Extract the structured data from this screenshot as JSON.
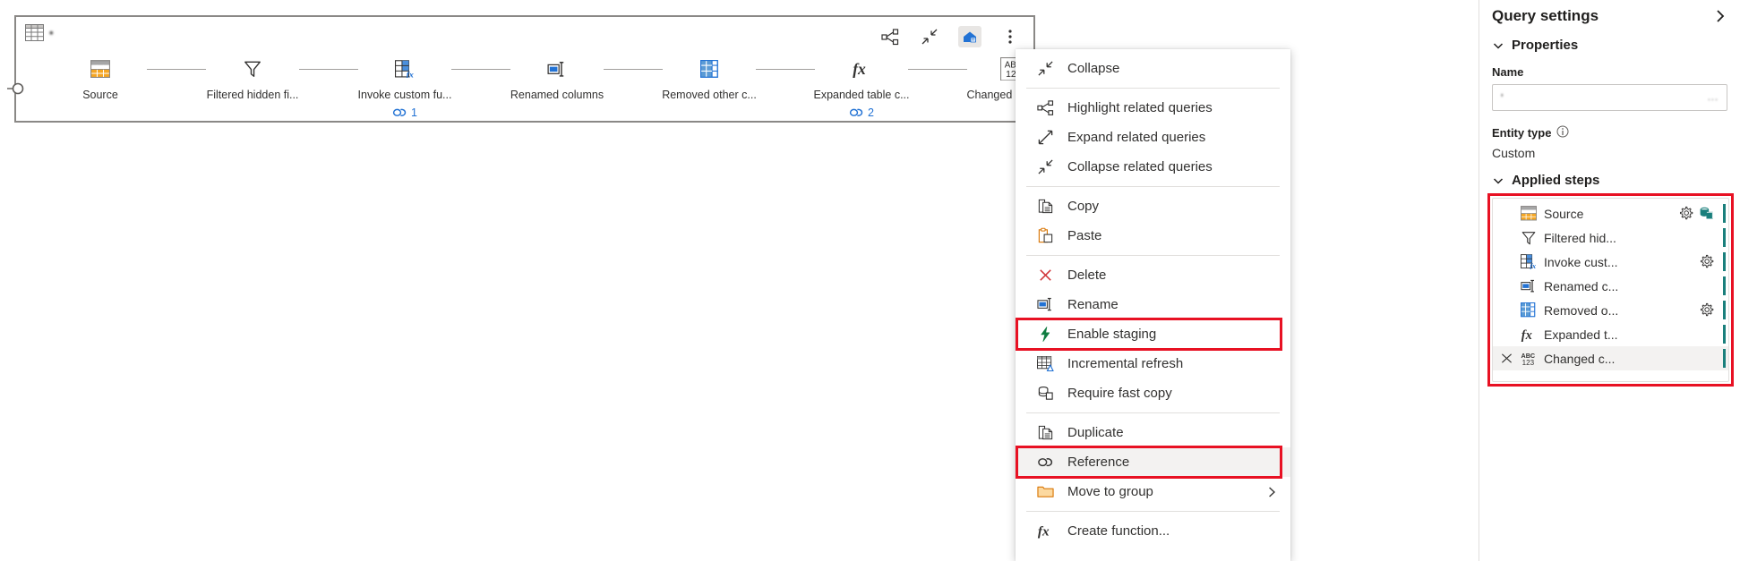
{
  "diagram": {
    "query_name": "•",
    "table_icon": "table-icon",
    "toolbar": [
      {
        "name": "highlight-related-queries-icon",
        "label": "Highlight related queries"
      },
      {
        "name": "collapse-icon",
        "label": "Collapse"
      },
      {
        "name": "home-icon",
        "label": "Go home"
      },
      {
        "name": "more-options-icon",
        "label": "More options"
      }
    ],
    "steps": [
      {
        "icon": "source-table-icon",
        "label": "Source",
        "refs": null
      },
      {
        "icon": "filter-icon",
        "label": "Filtered hidden fi...",
        "refs": null
      },
      {
        "icon": "invoke-function-icon",
        "label": "Invoke custom fu...",
        "refs": "1"
      },
      {
        "icon": "rename-columns-icon",
        "label": "Renamed columns",
        "refs": null
      },
      {
        "icon": "remove-columns-icon",
        "label": "Removed other c...",
        "refs": null
      },
      {
        "icon": "fx-icon",
        "label": "Expanded table c...",
        "refs": "2"
      },
      {
        "icon": "abc123-icon",
        "label": "Changed column...",
        "refs": null
      }
    ],
    "add_step_label": "+"
  },
  "context_menu": {
    "items": [
      {
        "icon": "collapse-icon",
        "label": "Collapse",
        "sep_after": true,
        "highlighted": false,
        "submenu": false
      },
      {
        "icon": "highlight-related-queries-icon",
        "label": "Highlight related queries",
        "sep_after": false,
        "highlighted": false,
        "submenu": false
      },
      {
        "icon": "expand-related-queries-icon",
        "label": "Expand related queries",
        "sep_after": false,
        "highlighted": false,
        "submenu": false
      },
      {
        "icon": "collapse-related-queries-icon",
        "label": "Collapse related queries",
        "sep_after": true,
        "highlighted": false,
        "submenu": false
      },
      {
        "icon": "copy-icon",
        "label": "Copy",
        "sep_after": false,
        "highlighted": false,
        "submenu": false
      },
      {
        "icon": "paste-icon",
        "label": "Paste",
        "sep_after": true,
        "highlighted": false,
        "submenu": false
      },
      {
        "icon": "delete-x-icon",
        "label": "Delete",
        "sep_after": false,
        "highlighted": false,
        "submenu": false
      },
      {
        "icon": "rename-icon",
        "label": "Rename",
        "sep_after": false,
        "highlighted": false,
        "submenu": false
      },
      {
        "icon": "enable-staging-icon",
        "label": "Enable staging",
        "sep_after": false,
        "highlighted": false,
        "submenu": false
      },
      {
        "icon": "incremental-refresh-icon",
        "label": "Incremental refresh",
        "sep_after": false,
        "highlighted": false,
        "submenu": false
      },
      {
        "icon": "require-fast-copy-icon",
        "label": "Require fast copy",
        "sep_after": true,
        "highlighted": false,
        "submenu": false
      },
      {
        "icon": "duplicate-icon",
        "label": "Duplicate",
        "sep_after": false,
        "highlighted": false,
        "submenu": false
      },
      {
        "icon": "reference-icon",
        "label": "Reference",
        "sep_after": false,
        "highlighted": true,
        "submenu": false
      },
      {
        "icon": "folder-icon",
        "label": "Move to group",
        "sep_after": true,
        "highlighted": false,
        "submenu": true
      },
      {
        "icon": "fx-icon",
        "label": "Create function...",
        "sep_after": false,
        "highlighted": false,
        "submenu": false
      }
    ],
    "highlight_color": "#e81123"
  },
  "query_settings": {
    "title": "Query settings",
    "collapse_icon": "chevron-right-icon",
    "properties": {
      "section_label": "Properties",
      "name_label": "Name",
      "name_value": "'",
      "name_ellipsis": "...",
      "entity_type_label": "Entity type",
      "entity_type_info_icon": "info-icon",
      "entity_type_value": "Custom"
    },
    "applied_steps": {
      "section_label": "Applied steps",
      "steps": [
        {
          "icon": "source-table-icon",
          "label": "Source",
          "gear": true,
          "extra_icon": "database-icon",
          "selected": false,
          "delete": false
        },
        {
          "icon": "filter-icon",
          "label": "Filtered hid...",
          "gear": false,
          "extra_icon": null,
          "selected": false,
          "delete": false
        },
        {
          "icon": "invoke-function-icon",
          "label": "Invoke cust...",
          "gear": true,
          "extra_icon": null,
          "selected": false,
          "delete": false
        },
        {
          "icon": "rename-columns-icon",
          "label": "Renamed c...",
          "gear": false,
          "extra_icon": null,
          "selected": false,
          "delete": false
        },
        {
          "icon": "remove-columns-icon",
          "label": "Removed o...",
          "gear": true,
          "extra_icon": null,
          "selected": false,
          "delete": false
        },
        {
          "icon": "fx-icon",
          "label": "Expanded t...",
          "gear": false,
          "extra_icon": null,
          "selected": false,
          "delete": false
        },
        {
          "icon": "abc123-icon",
          "label": "Changed c...",
          "gear": false,
          "extra_icon": null,
          "selected": true,
          "delete": true
        }
      ]
    }
  },
  "colors": {
    "accent_blue": "#2272d4",
    "highlight_red": "#e81123",
    "step_bar_teal": "#1a7f7c",
    "border_grey": "#8a8886"
  }
}
